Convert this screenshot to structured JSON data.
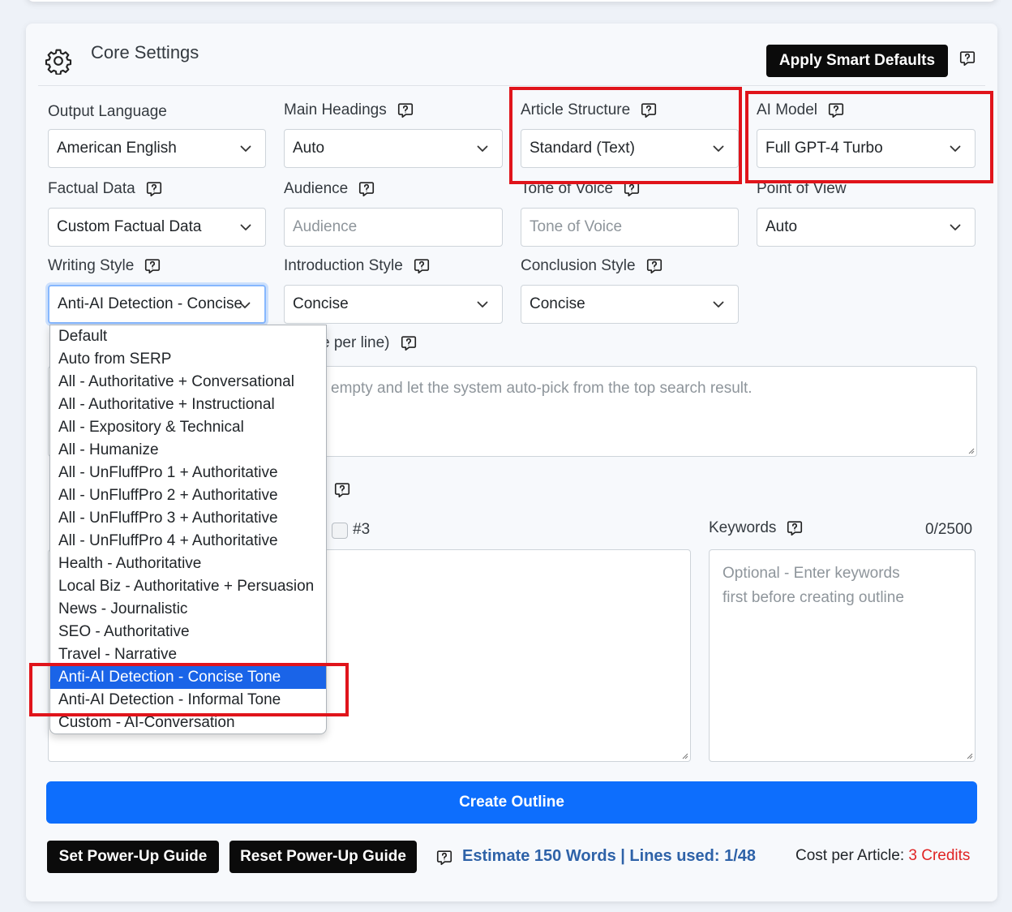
{
  "section": {
    "title": "Core Settings",
    "apply_defaults_label": "Apply Smart Defaults"
  },
  "fields": {
    "output_language": {
      "label": "Output Language",
      "value": "American English"
    },
    "main_headings": {
      "label": "Main Headings",
      "value": "Auto"
    },
    "article_structure": {
      "label": "Article Structure",
      "value": "Standard (Text)"
    },
    "ai_model": {
      "label": "AI Model",
      "value": "Full GPT-4 Turbo"
    },
    "factual_data": {
      "label": "Factual Data",
      "value": "Custom Factual Data"
    },
    "audience": {
      "label": "Audience",
      "placeholder": "Audience"
    },
    "tone_of_voice": {
      "label": "Tone of Voice",
      "placeholder": "Tone of Voice"
    },
    "point_of_view": {
      "label": "Point of View",
      "value": "Auto"
    },
    "writing_style": {
      "label": "Writing Style",
      "value": "Anti-AI Detection - Concise"
    },
    "introduction_style": {
      "label": "Introduction Style",
      "value": "Concise"
    },
    "conclusion_style": {
      "label": "Conclusion Style",
      "value": "Concise"
    }
  },
  "obscured": {
    "per_line_label": "e per line)",
    "textarea_placeholder": "empty and let the system auto-pick from the top search result.",
    "checkbox_label": "#3"
  },
  "keywords": {
    "label": "Keywords",
    "counter": "0/2500",
    "placeholder_line1": "Optional - Enter keywords",
    "placeholder_line2": "first before creating outline"
  },
  "writing_style_options": [
    "Default",
    "Auto from SERP",
    "All - Authoritative + Conversational",
    "All - Authoritative + Instructional",
    "All - Expository & Technical",
    "All - Humanize",
    "All - UnFluffPro 1 + Authoritative",
    "All - UnFluffPro 2 + Authoritative",
    "All - UnFluffPro 3 + Authoritative",
    "All - UnFluffPro 4 + Authoritative",
    "Health - Authoritative",
    "Local Biz - Authoritative + Persuasion",
    "News - Journalistic",
    "SEO - Authoritative",
    "Travel - Narrative",
    "Anti-AI Detection - Concise Tone",
    "Anti-AI Detection - Informal Tone",
    "Custom - AI-Conversation"
  ],
  "selected_option": "Anti-AI Detection - Concise Tone",
  "actions": {
    "create_outline": "Create Outline",
    "set_guide": "Set Power-Up Guide",
    "reset_guide": "Reset Power-Up Guide"
  },
  "footer": {
    "estimate": "Estimate 150 Words | Lines used: 1/48",
    "cost_label": "Cost per Article:",
    "cost_value": "3 Credits"
  },
  "colors": {
    "primary": "#0d6efd",
    "highlight": "#e0141b",
    "selected_option": "#1a64e8",
    "estimate_text": "#2e62a8"
  }
}
